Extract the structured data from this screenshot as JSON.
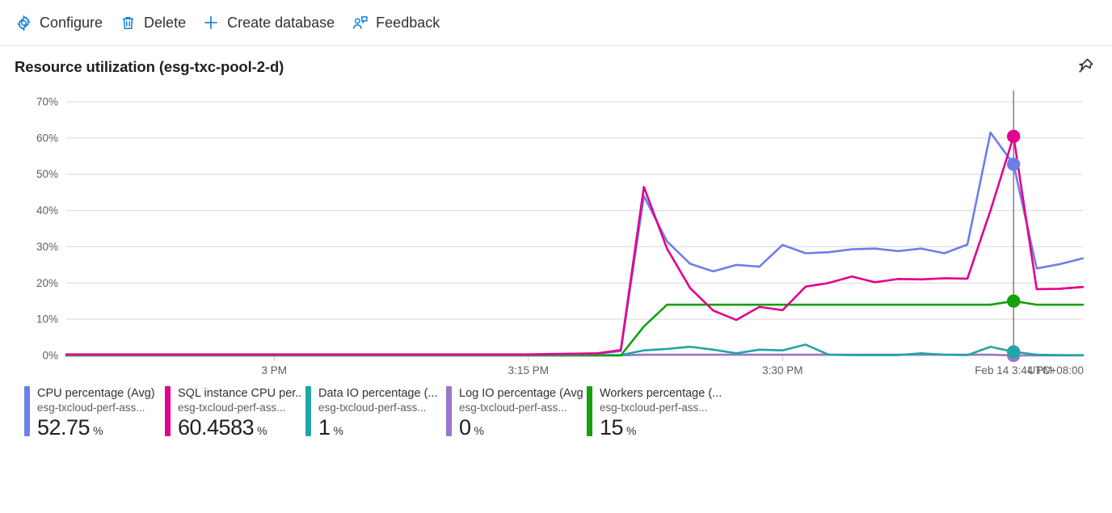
{
  "toolbar": {
    "items": [
      {
        "label": "Configure",
        "icon": "gear-icon"
      },
      {
        "label": "Delete",
        "icon": "trash-icon"
      },
      {
        "label": "Create database",
        "icon": "plus-icon"
      },
      {
        "label": "Feedback",
        "icon": "person-feedback-icon"
      }
    ]
  },
  "header": {
    "title": "Resource utilization (esg-txc-pool-2-d)",
    "pin_icon": "pin-icon"
  },
  "chart_data": {
    "type": "line",
    "title": "Resource utilization (esg-txc-pool-2-d)",
    "xlabel": "",
    "ylabel": "",
    "ylim": [
      0,
      70
    ],
    "grid": true,
    "legend_position": "bottom",
    "timezone": "UTC+08:00",
    "y_ticks": [
      "0%",
      "10%",
      "20%",
      "30%",
      "40%",
      "50%",
      "60%",
      "70%"
    ],
    "x_ticks": [
      "3 PM",
      "3:15 PM",
      "3:30 PM",
      "Feb 14 3:44 PM"
    ],
    "hover_time": "Feb 14 3:44 PM",
    "x": [
      0,
      1,
      2,
      3,
      4,
      5,
      6,
      7,
      8,
      9,
      10,
      11,
      12,
      13,
      14,
      15,
      16,
      17,
      18,
      19,
      20,
      21,
      22,
      23,
      24,
      25,
      26,
      27,
      28,
      29,
      30,
      31,
      32,
      33,
      34,
      35,
      36,
      37,
      38,
      39,
      40,
      41,
      42,
      43,
      44
    ],
    "series": [
      {
        "name": "CPU percentage (Avg)",
        "color": "#6e7ee8",
        "values": [
          0.2,
          0.2,
          0.2,
          0.2,
          0.2,
          0.2,
          0.2,
          0.2,
          0.2,
          0.2,
          0.2,
          0.2,
          0.2,
          0.2,
          0.2,
          0.2,
          0.2,
          0.2,
          0.2,
          0.2,
          0.2,
          0.3,
          0.4,
          0.5,
          1.2,
          44.0,
          31.5,
          25.3,
          23.2,
          25.0,
          24.5,
          30.5,
          28.2,
          28.5,
          29.3,
          29.5,
          28.8,
          29.5,
          28.2,
          30.6,
          61.5,
          52.75,
          24.0,
          25.2,
          26.8
        ]
      },
      {
        "name": "SQL instance CPU per...",
        "color": "#e3008c",
        "values": [
          0.3,
          0.3,
          0.3,
          0.3,
          0.3,
          0.3,
          0.3,
          0.3,
          0.3,
          0.3,
          0.3,
          0.3,
          0.3,
          0.3,
          0.3,
          0.3,
          0.3,
          0.3,
          0.3,
          0.3,
          0.3,
          0.4,
          0.5,
          0.6,
          1.5,
          46.5,
          29.5,
          18.6,
          12.4,
          9.8,
          13.4,
          12.5,
          19.0,
          20.0,
          21.8,
          20.2,
          21.1,
          21.0,
          21.3,
          21.2,
          40.0,
          60.4583,
          18.3,
          18.4,
          18.9
        ]
      },
      {
        "name": "Data IO percentage (...",
        "color": "#21a5a5",
        "values": [
          0.1,
          0.1,
          0.1,
          0.1,
          0.1,
          0.1,
          0.1,
          0.1,
          0.1,
          0.1,
          0.1,
          0.1,
          0.1,
          0.1,
          0.1,
          0.1,
          0.1,
          0.1,
          0.1,
          0.1,
          0.1,
          0.1,
          0.1,
          0.1,
          0.1,
          1.4,
          1.8,
          2.4,
          1.6,
          0.6,
          1.6,
          1.4,
          3.0,
          0.2,
          0.1,
          0.1,
          0.1,
          0.6,
          0.2,
          0.1,
          2.4,
          1.0,
          0.2,
          0.1,
          0.1
        ]
      },
      {
        "name": "Log IO percentage (Avg)",
        "color": "#9a76c9",
        "values": [
          0.05,
          0.05,
          0.05,
          0.05,
          0.05,
          0.05,
          0.05,
          0.05,
          0.05,
          0.05,
          0.05,
          0.05,
          0.05,
          0.05,
          0.05,
          0.05,
          0.05,
          0.05,
          0.05,
          0.05,
          0.05,
          0.05,
          0.05,
          0.05,
          0.05,
          0.2,
          0.2,
          0.2,
          0.2,
          0.2,
          0.2,
          0.2,
          0.2,
          0.2,
          0.2,
          0.2,
          0.2,
          0.2,
          0.2,
          0.2,
          0.2,
          0.0,
          0.0,
          0.0,
          0.0
        ]
      },
      {
        "name": "Workers percentage (...",
        "color": "#13a10e",
        "values": [
          0,
          0,
          0,
          0,
          0,
          0,
          0,
          0,
          0,
          0,
          0,
          0,
          0,
          0,
          0,
          0,
          0,
          0,
          0,
          0,
          0,
          0,
          0,
          0,
          0,
          8.0,
          14.0,
          14.0,
          14.0,
          14.0,
          14.0,
          14.0,
          14.0,
          14.0,
          14.0,
          14.0,
          14.0,
          14.0,
          14.0,
          14.0,
          14.0,
          15.0,
          14.0,
          14.0,
          14.0
        ]
      }
    ]
  },
  "legend": {
    "items": [
      {
        "metric": "CPU percentage (Avg)",
        "resource": "esg-txcloud-perf-ass...",
        "value": "52.75",
        "unit": "%",
        "color": "#6e7ee8"
      },
      {
        "metric": "SQL instance CPU per...",
        "resource": "esg-txcloud-perf-ass...",
        "value": "60.4583",
        "unit": "%",
        "color": "#e3008c"
      },
      {
        "metric": "Data IO percentage (...",
        "resource": "esg-txcloud-perf-ass...",
        "value": "1",
        "unit": "%",
        "color": "#21a5a5"
      },
      {
        "metric": "Log IO percentage (Avg)",
        "resource": "esg-txcloud-perf-ass...",
        "value": "0",
        "unit": "%",
        "color": "#9a76c9"
      },
      {
        "metric": "Workers percentage (...",
        "resource": "esg-txcloud-perf-ass...",
        "value": "15",
        "unit": "%",
        "color": "#13a10e"
      }
    ]
  }
}
